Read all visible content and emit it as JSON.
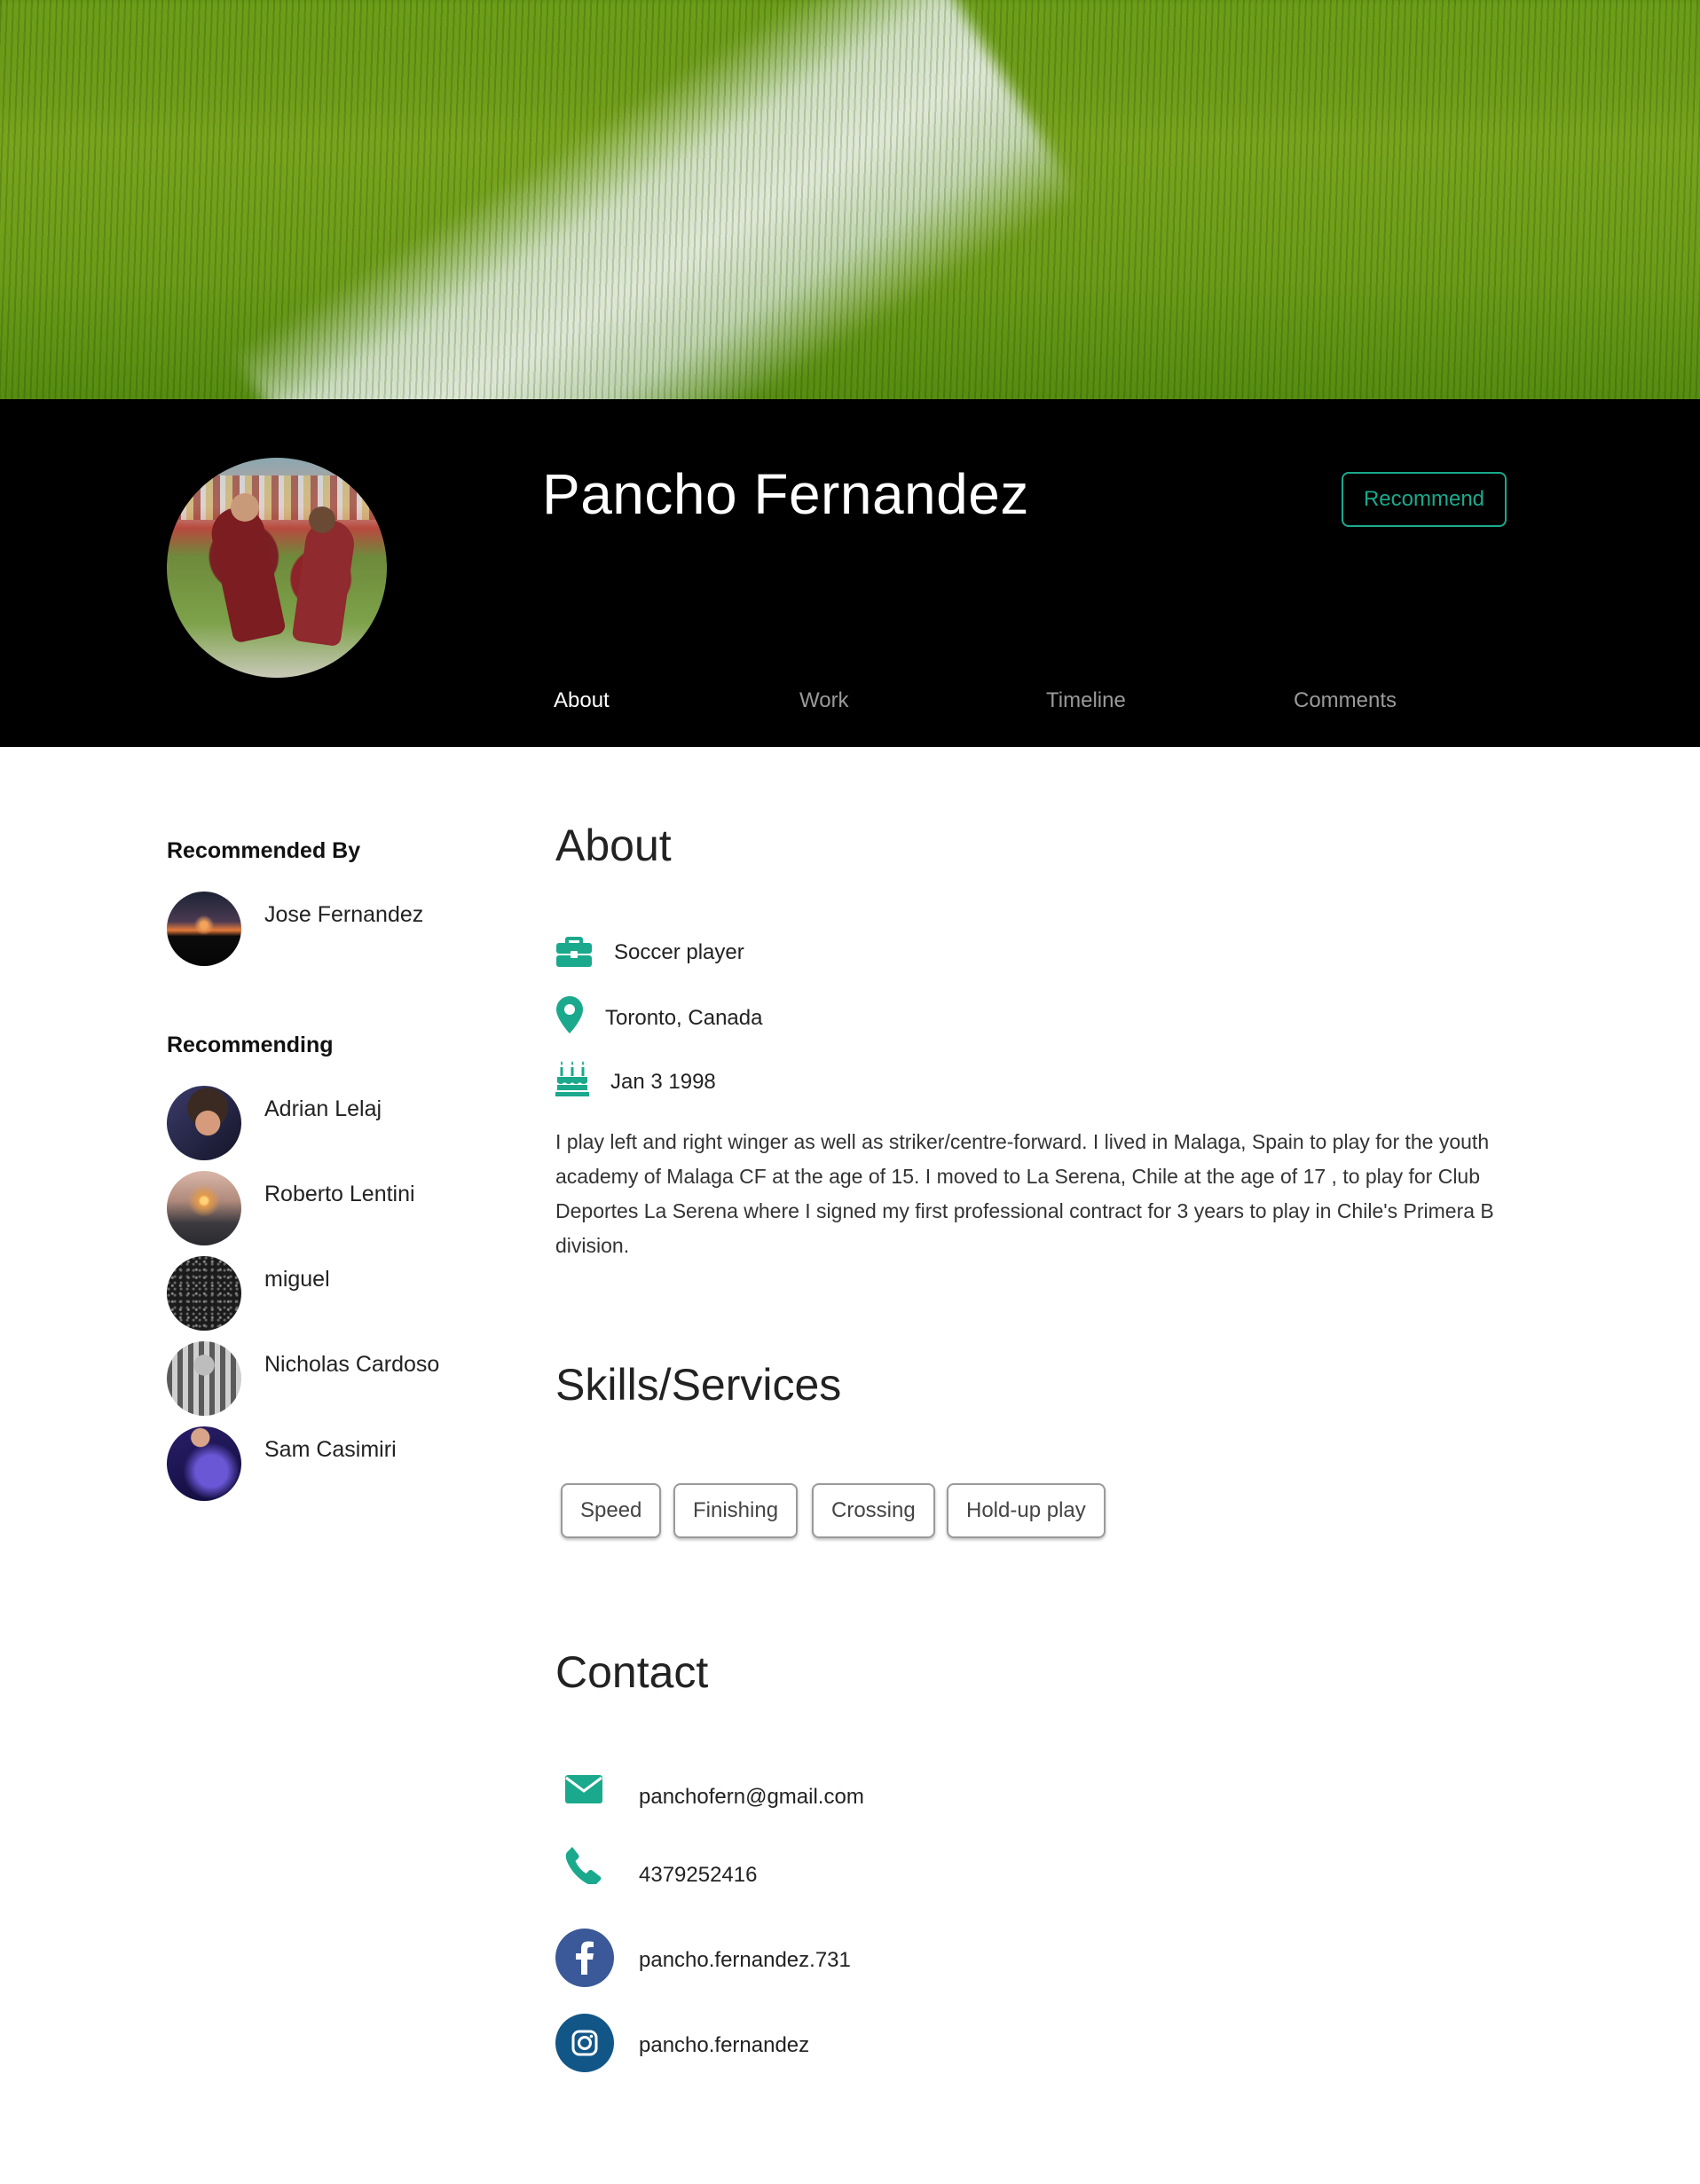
{
  "profile": {
    "name": "Pancho Fernandez",
    "recommend_label": "Recommend"
  },
  "tabs": [
    {
      "label": "About",
      "active": true
    },
    {
      "label": "Work",
      "active": false
    },
    {
      "label": "Timeline",
      "active": false
    },
    {
      "label": "Comments",
      "active": false
    }
  ],
  "sidebar": {
    "recommended_by_heading": "Recommended By",
    "recommended_by": [
      {
        "name": "Jose Fernandez"
      }
    ],
    "recommending_heading": "Recommending",
    "recommending": [
      {
        "name": "Adrian Lelaj"
      },
      {
        "name": "Roberto Lentini"
      },
      {
        "name": "miguel"
      },
      {
        "name": "Nicholas Cardoso"
      },
      {
        "name": "Sam Casimiri"
      }
    ]
  },
  "about": {
    "title": "About",
    "occupation": "Soccer player",
    "location": "Toronto, Canada",
    "birthday": "Jan 3 1998",
    "bio": "I play left and right winger as well as striker/centre-forward. I lived in Malaga, Spain to play for the youth academy of Malaga CF at the age of 15. I moved to La Serena, Chile at the age of 17 , to play for Club Deportes La Serena where I signed my first professional contract for 3 years to play in Chile's Primera B division."
  },
  "skills": {
    "title": "Skills/Services",
    "items": [
      "Speed",
      "Finishing",
      "Crossing",
      "Hold-up play"
    ]
  },
  "contact": {
    "title": "Contact",
    "email": "panchofern@gmail.com",
    "phone": "4379252416",
    "facebook": "pancho.fernandez.731",
    "instagram": "pancho.fernandez"
  },
  "colors": {
    "accent": "#1aa98c",
    "header_bg": "#000000",
    "facebook": "#3b5998",
    "instagram": "#125688"
  },
  "icons": {
    "occupation": "briefcase-icon",
    "location": "map-pin-icon",
    "birthday": "birthday-cake-icon",
    "email": "envelope-icon",
    "phone": "phone-icon",
    "facebook": "facebook-icon",
    "instagram": "instagram-icon"
  }
}
